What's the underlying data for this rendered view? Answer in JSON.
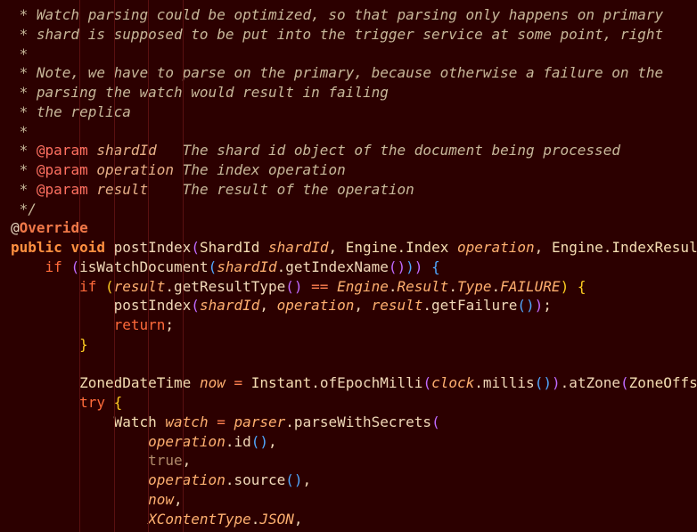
{
  "editor": {
    "lines": [
      [
        {
          "c": "c-comment",
          "t": "     * Watch parsing could be optimized, so that parsing only happens on primary"
        }
      ],
      [
        {
          "c": "c-comment",
          "t": "     * shard is supposed to be put into the trigger service at some point, right"
        }
      ],
      [
        {
          "c": "c-comment",
          "t": "     *"
        }
      ],
      [
        {
          "c": "c-comment",
          "t": "     * Note, we have to parse on the primary, because otherwise a failure on the"
        }
      ],
      [
        {
          "c": "c-comment",
          "t": "     * parsing the watch would result in failing"
        }
      ],
      [
        {
          "c": "c-comment",
          "t": "     * the replica"
        }
      ],
      [
        {
          "c": "c-comment",
          "t": "     *"
        }
      ],
      [
        {
          "c": "c-comment",
          "t": "     * "
        },
        {
          "c": "c-tag",
          "t": "@param"
        },
        {
          "c": "c-comment",
          "t": " "
        },
        {
          "c": "c-param",
          "t": "shardId"
        },
        {
          "c": "c-comment",
          "t": "   The shard id object of the document being processed"
        }
      ],
      [
        {
          "c": "c-comment",
          "t": "     * "
        },
        {
          "c": "c-tag",
          "t": "@param"
        },
        {
          "c": "c-comment",
          "t": " "
        },
        {
          "c": "c-param",
          "t": "operation"
        },
        {
          "c": "c-comment",
          "t": " The index operation"
        }
      ],
      [
        {
          "c": "c-comment",
          "t": "     * "
        },
        {
          "c": "c-tag",
          "t": "@param"
        },
        {
          "c": "c-comment",
          "t": " "
        },
        {
          "c": "c-param",
          "t": "result"
        },
        {
          "c": "c-comment",
          "t": "    The result of the operation"
        }
      ],
      [
        {
          "c": "c-comment",
          "t": "     */"
        }
      ],
      [
        {
          "c": "c-punct",
          "t": "    "
        },
        {
          "c": "c-at",
          "t": "@"
        },
        {
          "c": "c-annot",
          "t": "Override"
        }
      ],
      [
        {
          "c": "c-punct",
          "t": "    "
        },
        {
          "c": "c-kw",
          "t": "public"
        },
        {
          "c": "c-punct",
          "t": " "
        },
        {
          "c": "c-kw",
          "t": "void"
        },
        {
          "c": "c-punct",
          "t": " "
        },
        {
          "c": "c-ident",
          "t": "postIndex"
        },
        {
          "c": "c-paren1",
          "t": "("
        },
        {
          "c": "c-type",
          "t": "ShardId"
        },
        {
          "c": "c-punct",
          "t": " "
        },
        {
          "c": "c-var",
          "t": "shardId"
        },
        {
          "c": "c-punct",
          "t": ", "
        },
        {
          "c": "c-type",
          "t": "Engine.Index"
        },
        {
          "c": "c-punct",
          "t": " "
        },
        {
          "c": "c-var",
          "t": "operation"
        },
        {
          "c": "c-punct",
          "t": ", "
        },
        {
          "c": "c-type",
          "t": "Engine.IndexResult"
        }
      ],
      [
        {
          "c": "c-punct",
          "t": "        "
        },
        {
          "c": "c-kw-ctrl",
          "t": "if"
        },
        {
          "c": "c-punct",
          "t": " "
        },
        {
          "c": "c-paren1",
          "t": "("
        },
        {
          "c": "c-ident",
          "t": "isWatchDocument"
        },
        {
          "c": "c-paren2",
          "t": "("
        },
        {
          "c": "c-var",
          "t": "shardId"
        },
        {
          "c": "c-punct",
          "t": ".getIndexName"
        },
        {
          "c": "c-paren1",
          "t": "()"
        },
        {
          "c": "c-paren2",
          "t": ")"
        },
        {
          "c": "c-paren1",
          "t": ")"
        },
        {
          "c": "c-punct",
          "t": " "
        },
        {
          "c": "c-paren2",
          "t": "{"
        }
      ],
      [
        {
          "c": "c-punct",
          "t": "            "
        },
        {
          "c": "c-kw-ctrl",
          "t": "if"
        },
        {
          "c": "c-punct",
          "t": " "
        },
        {
          "c": "c-brace",
          "t": "("
        },
        {
          "c": "c-var",
          "t": "result"
        },
        {
          "c": "c-punct",
          "t": ".getResultType"
        },
        {
          "c": "c-paren1",
          "t": "()"
        },
        {
          "c": "c-punct",
          "t": " "
        },
        {
          "c": "c-op",
          "t": "=="
        },
        {
          "c": "c-punct",
          "t": " "
        },
        {
          "c": "c-var",
          "t": "Engine"
        },
        {
          "c": "c-punct",
          "t": "."
        },
        {
          "c": "c-var",
          "t": "Result"
        },
        {
          "c": "c-punct",
          "t": "."
        },
        {
          "c": "c-var",
          "t": "Type"
        },
        {
          "c": "c-punct",
          "t": "."
        },
        {
          "c": "c-const",
          "t": "FAILURE"
        },
        {
          "c": "c-brace",
          "t": ")"
        },
        {
          "c": "c-punct",
          "t": " "
        },
        {
          "c": "c-brace",
          "t": "{"
        }
      ],
      [
        {
          "c": "c-punct",
          "t": "                "
        },
        {
          "c": "c-ident",
          "t": "postIndex"
        },
        {
          "c": "c-paren1",
          "t": "("
        },
        {
          "c": "c-var",
          "t": "shardId"
        },
        {
          "c": "c-punct",
          "t": ", "
        },
        {
          "c": "c-var",
          "t": "operation"
        },
        {
          "c": "c-punct",
          "t": ", "
        },
        {
          "c": "c-var",
          "t": "result"
        },
        {
          "c": "c-punct",
          "t": ".getFailure"
        },
        {
          "c": "c-paren2",
          "t": "()"
        },
        {
          "c": "c-paren1",
          "t": ")"
        },
        {
          "c": "c-punct",
          "t": ";"
        }
      ],
      [
        {
          "c": "c-punct",
          "t": "                "
        },
        {
          "c": "c-kw-ctrl",
          "t": "return"
        },
        {
          "c": "c-punct",
          "t": ";"
        }
      ],
      [
        {
          "c": "c-punct",
          "t": "            "
        },
        {
          "c": "c-brace",
          "t": "}"
        }
      ],
      [
        {
          "c": "c-punct",
          "t": ""
        }
      ],
      [
        {
          "c": "c-punct",
          "t": "            "
        },
        {
          "c": "c-type",
          "t": "ZonedDateTime"
        },
        {
          "c": "c-punct",
          "t": " "
        },
        {
          "c": "c-var",
          "t": "now"
        },
        {
          "c": "c-punct",
          "t": " "
        },
        {
          "c": "c-op",
          "t": "="
        },
        {
          "c": "c-punct",
          "t": " "
        },
        {
          "c": "c-type",
          "t": "Instant"
        },
        {
          "c": "c-punct",
          "t": ".ofEpochMilli"
        },
        {
          "c": "c-paren1",
          "t": "("
        },
        {
          "c": "c-var",
          "t": "clock"
        },
        {
          "c": "c-punct",
          "t": ".millis"
        },
        {
          "c": "c-paren2",
          "t": "()"
        },
        {
          "c": "c-paren1",
          "t": ")"
        },
        {
          "c": "c-punct",
          "t": ".atZone"
        },
        {
          "c": "c-paren1",
          "t": "("
        },
        {
          "c": "c-type",
          "t": "ZoneOffset"
        }
      ],
      [
        {
          "c": "c-punct",
          "t": "            "
        },
        {
          "c": "c-kw-ctrl",
          "t": "try"
        },
        {
          "c": "c-punct",
          "t": " "
        },
        {
          "c": "c-brace",
          "t": "{"
        }
      ],
      [
        {
          "c": "c-punct",
          "t": "                "
        },
        {
          "c": "c-type",
          "t": "Watch"
        },
        {
          "c": "c-punct",
          "t": " "
        },
        {
          "c": "c-var",
          "t": "watch"
        },
        {
          "c": "c-punct",
          "t": " "
        },
        {
          "c": "c-op",
          "t": "="
        },
        {
          "c": "c-punct",
          "t": " "
        },
        {
          "c": "c-var",
          "t": "parser"
        },
        {
          "c": "c-punct",
          "t": ".parseWithSecrets"
        },
        {
          "c": "c-paren1",
          "t": "("
        }
      ],
      [
        {
          "c": "c-punct",
          "t": "                    "
        },
        {
          "c": "c-var",
          "t": "operation"
        },
        {
          "c": "c-punct",
          "t": ".id"
        },
        {
          "c": "c-paren2",
          "t": "()"
        },
        {
          "c": "c-punct",
          "t": ","
        }
      ],
      [
        {
          "c": "c-punct",
          "t": "                    "
        },
        {
          "c": "c-true",
          "t": "true"
        },
        {
          "c": "c-punct",
          "t": ","
        }
      ],
      [
        {
          "c": "c-punct",
          "t": "                    "
        },
        {
          "c": "c-var",
          "t": "operation"
        },
        {
          "c": "c-punct",
          "t": ".source"
        },
        {
          "c": "c-paren2",
          "t": "()"
        },
        {
          "c": "c-punct",
          "t": ","
        }
      ],
      [
        {
          "c": "c-punct",
          "t": "                    "
        },
        {
          "c": "c-var",
          "t": "now"
        },
        {
          "c": "c-punct",
          "t": ","
        }
      ],
      [
        {
          "c": "c-punct",
          "t": "                    "
        },
        {
          "c": "c-const",
          "t": "XContentType"
        },
        {
          "c": "c-punct",
          "t": "."
        },
        {
          "c": "c-const",
          "t": "JSON"
        },
        {
          "c": "c-punct",
          "t": ","
        }
      ]
    ]
  }
}
